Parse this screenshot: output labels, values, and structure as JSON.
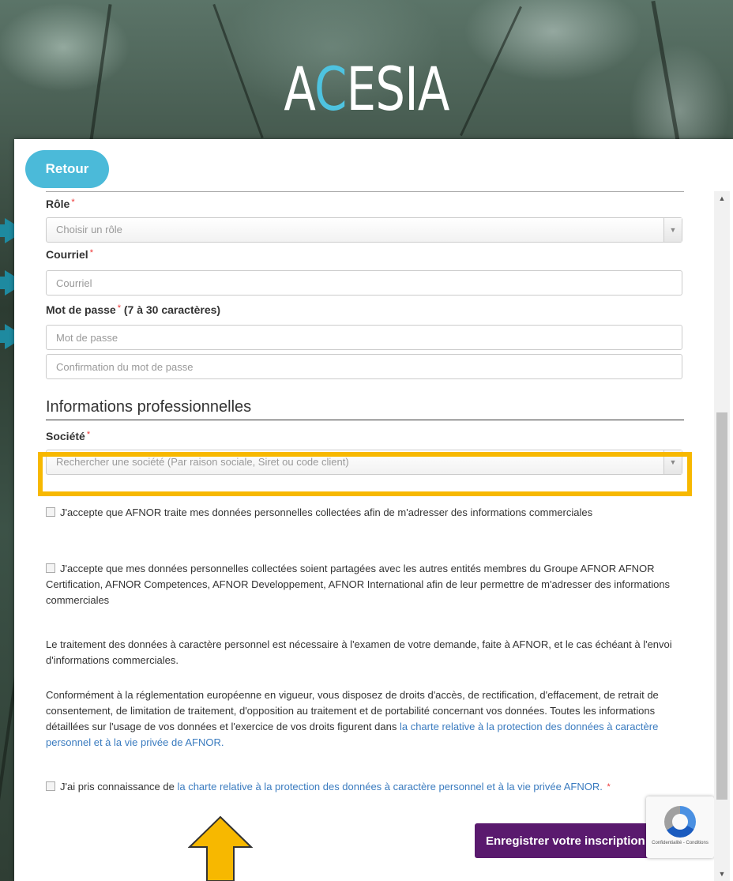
{
  "header": {
    "logo_prefix": "A",
    "logo_accent": "C",
    "logo_suffix": "ESIA"
  },
  "back_button": {
    "label": "Retour"
  },
  "form": {
    "role": {
      "label": "Rôle",
      "required": "*",
      "placeholder": "Choisir un rôle"
    },
    "email": {
      "label": "Courriel",
      "required": "*",
      "placeholder": "Courriel"
    },
    "password": {
      "label": "Mot de passe",
      "required": "*",
      "hint": "(7 à 30 caractères)",
      "placeholder": "Mot de passe",
      "confirm_placeholder": "Confirmation du mot de passe"
    },
    "section_title": "Informations professionnelles",
    "company": {
      "label": "Société",
      "required": "*",
      "placeholder": "Rechercher une société (Par raison sociale, Siret ou code client)"
    }
  },
  "consents": {
    "marketing": "J'accepte que AFNOR traite mes données personnelles collectées afin de m'adresser des informations commerciales",
    "sharing": "J'accepte que mes données personnelles collectées soient partagées avec les autres entités membres du Groupe AFNOR AFNOR Certification, AFNOR Competences, AFNOR Developpement, AFNOR International afin de leur permettre de m'adresser des informations commerciales",
    "charter_prefix": "J'ai pris connaissance de",
    "charter_link": "la charte relative à la protection des données à caractère personnel et à la vie privée AFNOR.",
    "charter_required": "*"
  },
  "info": {
    "processing": "Le traitement des données à caractère personnel est nécessaire à l'examen de votre demande, faite à AFNOR, et le cas échéant à l'envoi d'informations commerciales.",
    "rights_text": "Conformément à la réglementation européenne en vigueur, vous disposez de droits d'accès, de rectification, d'effacement, de retrait de consentement, de limitation de traitement, d'opposition au traitement et de portabilité concernant vos données. Toutes les informations détaillées sur l'usage de vos données et l'exercice de vos droits figurent dans",
    "rights_link": "la charte relative à la protection des données à caractère personnel et à la vie privée de AFNOR."
  },
  "submit_button": {
    "label": "Enregistrer votre inscription"
  },
  "recaptcha": {
    "terms": "Confidentialité - Conditions"
  },
  "colors": {
    "back_button": "#4bbad9",
    "submit_button": "#5a1a6e",
    "highlight": "#f7b800",
    "arrow_teal": "#1e8aa0",
    "link": "#3a7bbf"
  }
}
